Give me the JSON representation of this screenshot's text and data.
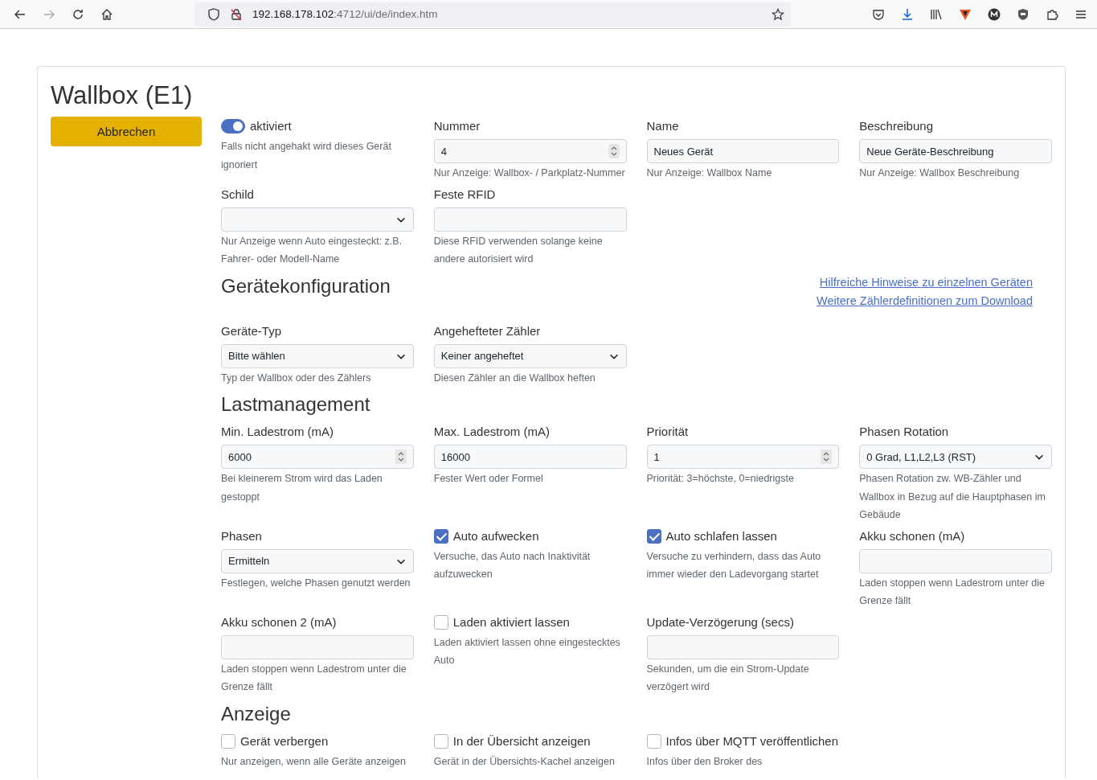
{
  "browser": {
    "url_host": "192.168.178.102",
    "url_rest": ":4712/ui/de/index.htm"
  },
  "title": "Wallbox (E1)",
  "cancel_button": "Abbrechen",
  "sections": [
    {
      "fields": [
        {
          "kind": "toggle",
          "label": "aktiviert",
          "checked": true,
          "help": "Falls nicht angehakt wird dieses Gerät ignoriert"
        },
        {
          "kind": "number",
          "label": "Nummer",
          "value": "4",
          "help": "Nur Anzeige: Wallbox- / Parkplatz-Nummer"
        },
        {
          "kind": "text",
          "label": "Name",
          "value": "Neues Gerät",
          "help": "Nur Anzeige: Wallbox Name"
        },
        {
          "kind": "text",
          "label": "Beschreibung",
          "value": "Neue Geräte-Beschreibung",
          "help": "Nur Anzeige: Wallbox Beschreibung"
        },
        {
          "kind": "select",
          "label": "Schild",
          "help": "Nur Anzeige wenn Auto eingesteckt: z.B. Fahrer- oder Modell-Name"
        },
        {
          "kind": "text",
          "label": "Feste RFID",
          "help": "Diese RFID verwenden solange keine andere autorisiert wird"
        }
      ]
    },
    {
      "heading": "Gerätekonfiguration",
      "links": [
        "Hilfreiche Hinweise zu einzelnen Geräten",
        "Weitere Zählerdefinitionen zum Download"
      ],
      "fields": [
        {
          "kind": "select",
          "label": "Geräte-Typ",
          "value": "Bitte wählen",
          "help": "Typ der Wallbox oder des Zählers"
        },
        {
          "kind": "select",
          "label": "Angehefteter Zähler",
          "value": "Keiner angeheftet",
          "help": "Diesen Zähler an die Wallbox heften"
        }
      ]
    },
    {
      "heading": "Lastmanagement",
      "fields": [
        {
          "kind": "number",
          "label": "Min. Ladestrom (mA)",
          "value": "6000",
          "help": "Bei kleinerem Strom wird das Laden gestoppt"
        },
        {
          "kind": "text",
          "label": "Max. Ladestrom (mA)",
          "value": "16000",
          "help": "Fester Wert oder Formel"
        },
        {
          "kind": "number",
          "label": "Priorität",
          "value": "1",
          "help": "Priorität: 3=höchste, 0=niedrigste"
        },
        {
          "kind": "select",
          "label": "Phasen Rotation",
          "value": "0 Grad, L1,L2,L3 (RST)",
          "help": "Phasen Rotation zw. WB-Zähler und Wallbox in Bezug auf die Hauptphasen im Gebäude"
        },
        {
          "kind": "select",
          "label": "Phasen",
          "value": "Ermitteln",
          "help": "Festlegen, welche Phasen genutzt werden"
        },
        {
          "kind": "checkbox",
          "label": "Auto aufwecken",
          "checked": true,
          "help": "Versuche, das Auto nach Inaktivität aufzuwecken"
        },
        {
          "kind": "checkbox",
          "label": "Auto schlafen lassen",
          "checked": true,
          "help": "Versuche zu verhindern, dass das Auto immer wieder den Ladevorgang startet"
        },
        {
          "kind": "text",
          "label": "Akku schonen (mA)",
          "help": "Laden stoppen wenn Ladestrom unter die Grenze fällt"
        },
        {
          "kind": "text",
          "label": "Akku schonen 2 (mA)",
          "help": "Laden stoppen wenn Ladestrom unter die Grenze fällt"
        },
        {
          "kind": "checkbox",
          "label": "Laden aktiviert lassen",
          "checked": false,
          "help": "Laden aktiviert lassen ohne eingestecktes Auto"
        },
        {
          "kind": "text",
          "label": "Update-Verzögerung (secs)",
          "help": "Sekunden, um die ein Strom-Update verzögert wird"
        }
      ]
    },
    {
      "heading": "Anzeige",
      "fields": [
        {
          "kind": "checkbox",
          "label": "Gerät verbergen",
          "checked": false,
          "help": "Nur anzeigen, wenn alle Geräte anzeigen"
        },
        {
          "kind": "checkbox",
          "label": "In der Übersicht anzeigen",
          "checked": false,
          "help": "Gerät in der Übersichts-Kachel anzeigen"
        },
        {
          "kind": "checkbox",
          "label": "Infos über MQTT veröffentlichen",
          "checked": false,
          "help": "Infos über den Broker des"
        }
      ]
    }
  ]
}
